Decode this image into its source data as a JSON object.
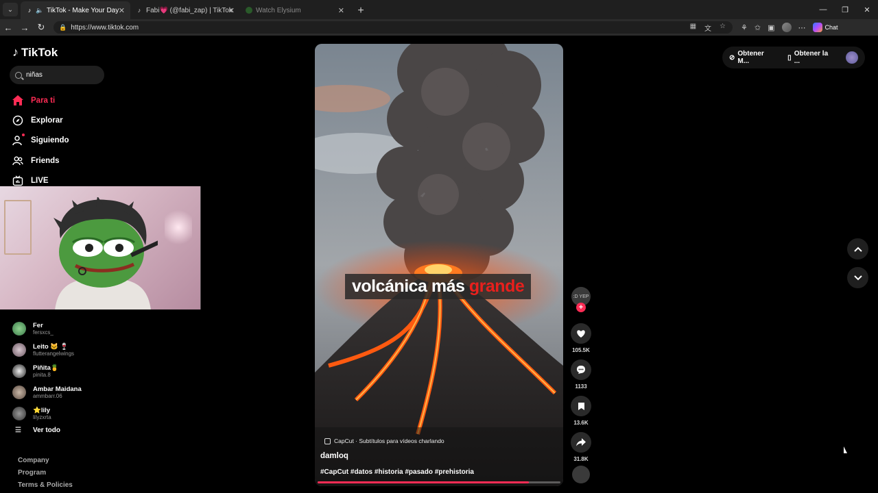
{
  "browser": {
    "tabs": [
      {
        "title": "TikTok - Make Your Day",
        "active": true
      },
      {
        "title": "Fabi💗 (@fabi_zap) | TikTok",
        "active": false
      },
      {
        "title": "Watch Elysium",
        "active": false
      }
    ],
    "url": "https://www.tiktok.com",
    "chat_label": "Chat"
  },
  "tiktok": {
    "logo_text": "TikTok",
    "search_value": "niñas",
    "nav": [
      {
        "label": "Para ti",
        "icon": "home-icon",
        "active": true
      },
      {
        "label": "Explorar",
        "icon": "compass-icon"
      },
      {
        "label": "Siguiendo",
        "icon": "following-icon"
      },
      {
        "label": "Friends",
        "icon": "friends-icon"
      },
      {
        "label": "LIVE",
        "icon": "live-icon"
      }
    ],
    "following_accounts": [
      {
        "name": "Fer",
        "handle": "fersxcs_"
      },
      {
        "name": "Leito 🐱 🍷",
        "handle": "flutterangelwings"
      },
      {
        "name": "Piñita🍍",
        "handle": "pinita.8"
      },
      {
        "name": "Ambar Maidana",
        "handle": "ammbarr.06"
      },
      {
        "name": "⭐lily",
        "handle": "lilyzxrta"
      }
    ],
    "see_all": "Ver todo",
    "footer": [
      "Company",
      "Program",
      "Terms & Policies"
    ],
    "top_right": {
      "item1": "Obtener M...",
      "item2": "Obtener la ..."
    }
  },
  "video": {
    "caption_main": "volcánica más ",
    "caption_highlight": "grande",
    "capcut_label": "CapCut · Subtítulos para vídeos charlando",
    "author": "damloq",
    "hashtags": "#CapCut #datos #historia #pasado #prehistoria",
    "progress": 0.87,
    "creator_label": ":D YEP",
    "likes": "105.5K",
    "comments": "1133",
    "saves": "13.6K",
    "shares": "31.8K"
  },
  "colors": {
    "accent": "#fe2c55",
    "caption_highlight": "#e8201d"
  }
}
